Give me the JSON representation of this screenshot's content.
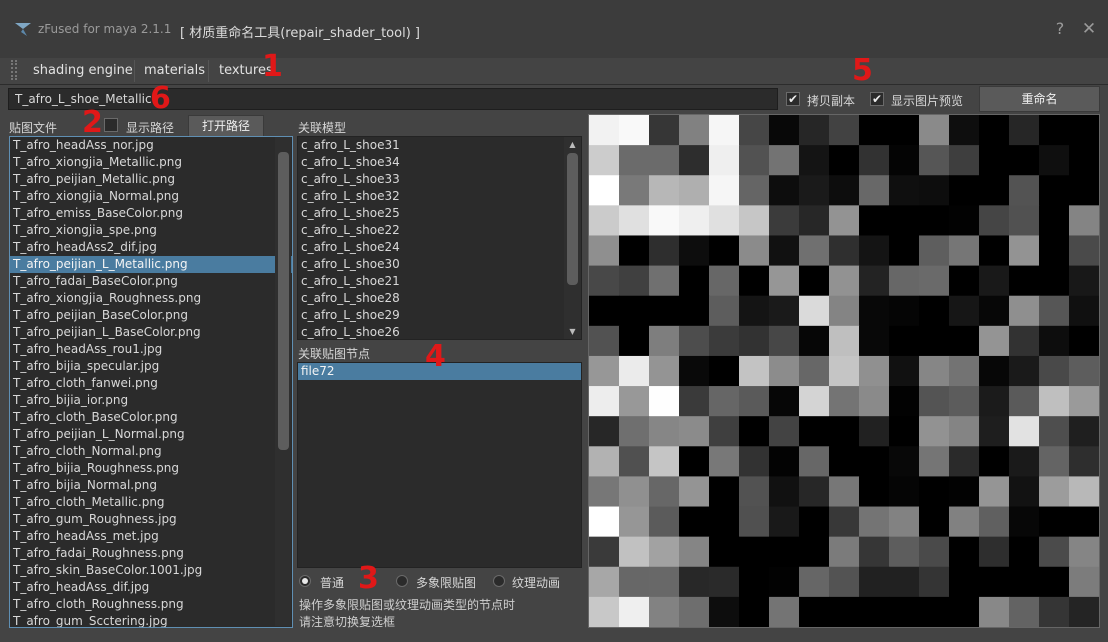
{
  "window": {
    "app_title": "zFused for maya 2.1.1",
    "tool_title": "[ 材质重命名工具(repair_shader_tool) ]",
    "help": "?",
    "close": "✕"
  },
  "tabs": [
    "shading engine",
    "materials",
    "textures"
  ],
  "name_field": {
    "value": "T_afro_L_shoe_Metallic"
  },
  "options": {
    "copy_label": "拷贝副本",
    "copy_checked": true,
    "preview_label": "显示图片预览",
    "preview_checked": true,
    "rename_button": "重命名"
  },
  "texture_panel": {
    "label": "贴图文件",
    "show_path_label": "显示路径",
    "show_path_checked": false,
    "open_path_button": "打开路径",
    "selected_index": 7,
    "items": [
      "T_afro_headAss_nor.jpg",
      "T_afro_xiongjia_Metallic.png",
      "T_afro_peijian_Metallic.png",
      "T_afro_xiongjia_Normal.png",
      "T_afro_emiss_BaseColor.png",
      "T_afro_xiongjia_spe.png",
      "T_afro_headAss2_dif.jpg",
      "T_afro_peijian_L_Metallic.png",
      "T_afro_fadai_BaseColor.png",
      "T_afro_xiongjia_Roughness.png",
      "T_afro_peijian_BaseColor.png",
      "T_afro_peijian_L_BaseColor.png",
      "T_afro_headAss_rou1.jpg",
      "T_afro_bijia_specular.jpg",
      "T_afro_cloth_fanwei.png",
      "T_afro_bijia_ior.png",
      "T_afro_cloth_BaseColor.png",
      "T_afro_peijian_L_Normal.png",
      "T_afro_cloth_Normal.png",
      "T_afro_bijia_Roughness.png",
      "T_afro_bijia_Normal.png",
      "T_afro_cloth_Metallic.png",
      "T_afro_gum_Roughness.jpg",
      "T_afro_headAss_met.jpg",
      "T_afro_fadai_Roughness.png",
      "T_afro_skin_BaseColor.1001.jpg",
      "T_afro_headAss_dif.jpg",
      "T_afro_cloth_Roughness.png",
      "T_afro_gum_Sccter‍ing.jpg"
    ]
  },
  "model_panel": {
    "label": "关联模型",
    "items": [
      "c_afro_L_shoe31",
      "c_afro_L_shoe34",
      "c_afro_L_shoe33",
      "c_afro_L_shoe32",
      "c_afro_L_shoe25",
      "c_afro_L_shoe22",
      "c_afro_L_shoe24",
      "c_afro_L_shoe30",
      "c_afro_L_shoe21",
      "c_afro_L_shoe28",
      "c_afro_L_shoe29",
      "c_afro_L_shoe26"
    ]
  },
  "node_panel": {
    "label": "关联贴图节点",
    "items": [
      "file72"
    ],
    "selected_index": 0
  },
  "mode": {
    "options": [
      "普通",
      "多象限贴图",
      "纹理动画"
    ],
    "selected": "普通"
  },
  "notes": [
    "操作多象限贴图或纹理动画类型的节点时",
    "请注意切换复选框"
  ],
  "annotations": [
    "1",
    "2",
    "3",
    "4",
    "5",
    "6"
  ],
  "colors": {
    "selection": "#4a7ca0",
    "annotation": "#e01818",
    "background": "#444444"
  }
}
